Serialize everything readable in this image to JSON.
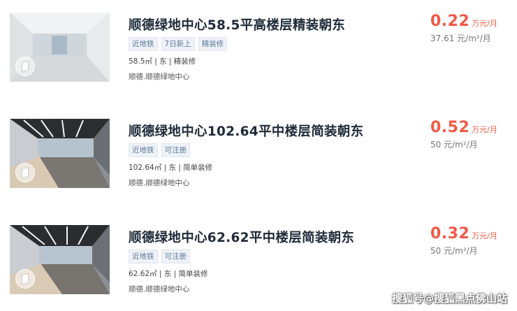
{
  "listings": [
    {
      "title": "顺德绿地中心58.5平高楼层精装朝东",
      "tags": [
        "近地铁",
        "7日新上",
        "精装修"
      ],
      "meta": "58.5㎡ | 东 | 精装修",
      "location": "顺德.顺德绿地中心",
      "price": "0.22",
      "price_unit": "万元/月",
      "unit_price": "37.61 元/m²/月"
    },
    {
      "title": "顺德绿地中心102.64平中楼层简装朝东",
      "tags": [
        "近地铁",
        "可注册"
      ],
      "meta": "102.64㎡ | 东 | 简单装修",
      "location": "顺德.顺德绿地中心",
      "price": "0.52",
      "price_unit": "万元/月",
      "unit_price": "50 元/m²/月"
    },
    {
      "title": "顺德绿地中心62.62平中楼层简装朝东",
      "tags": [
        "近地铁",
        "可注册"
      ],
      "meta": "62.62㎡ | 东 | 简单装修",
      "location": "顺德.顺德绿地中心",
      "price": "0.32",
      "price_unit": "万元/月",
      "unit_price": "50 元/m²/月"
    }
  ],
  "watermark": "搜狐号@搜狐黑点佛山站",
  "colors": {
    "price": "#f05a47",
    "title": "#202b3a",
    "tag_text": "#5b7a99",
    "tag_bg": "#eef2f7"
  },
  "icons": [
    "vr-360-icon"
  ]
}
